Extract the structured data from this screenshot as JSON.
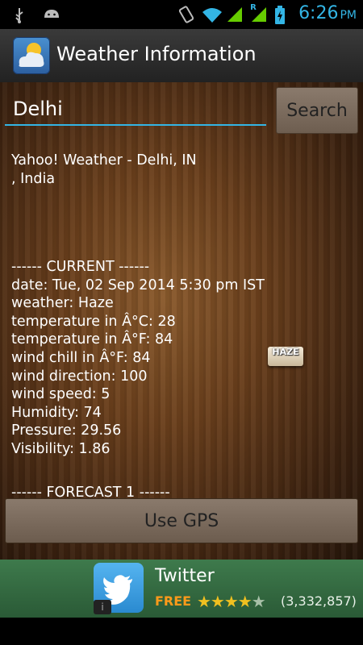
{
  "status_bar": {
    "time": "6:26",
    "ampm": "PM",
    "icons": [
      "usb-icon",
      "android-icon",
      "vibrate-icon",
      "wifi-icon",
      "signal-icon",
      "roaming-signal-icon",
      "battery-icon"
    ],
    "roaming_mark": "R"
  },
  "app": {
    "title": "Weather Information",
    "icon": "weather-cloud-sun-icon"
  },
  "search": {
    "city_value": "Delhi",
    "button_label": "Search"
  },
  "report": {
    "title_line1": "Yahoo! Weather - Delhi, IN",
    "title_line2": ", India",
    "current_header": "------ CURRENT ------",
    "date": "date: Tue, 02 Sep 2014 5:30 pm IST",
    "weather": "weather: Haze",
    "temp_c": "temperature in Â°C: 28",
    "temp_f": "temperature in Â°F: 84",
    "wind_chill": "wind chill in Â°F: 84",
    "wind_direction": "wind direction: 100",
    "wind_speed": "wind speed: 5",
    "humidity": "Humidity: 74",
    "pressure": "Pressure: 29.56",
    "visibility": "Visibility: 1.86",
    "forecast_header": "------ FORECAST 1 ------"
  },
  "condition_badge": {
    "label": "HAZE"
  },
  "gps": {
    "button_label": "Use  GPS"
  },
  "ad": {
    "app_name": "Twitter",
    "price": "FREE",
    "rating": 4.5,
    "rating_count": "(3,332,857)",
    "info_symbol": "i"
  }
}
